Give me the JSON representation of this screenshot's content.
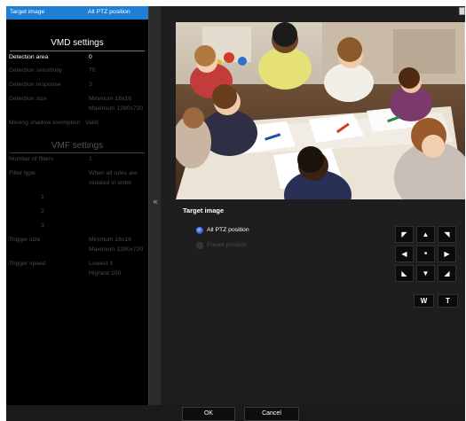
{
  "settings_panel": {
    "target_row": {
      "label": "Target image",
      "value": "All PTZ position"
    },
    "vmd_title": "VMD settings",
    "vmd_rows": [
      {
        "label": "Detection area",
        "value": "0",
        "enabled": true
      },
      {
        "label": "Detection sensitivity",
        "value": "70",
        "enabled": false
      },
      {
        "label": "Detection response",
        "value": "3",
        "enabled": false
      },
      {
        "label": "Detection size",
        "value": "Minimum 16x16",
        "value2": "Maximum 1280x720",
        "enabled": false
      },
      {
        "label": "Moving shadow exemption",
        "value": "Valid",
        "enabled": false
      }
    ],
    "vmf_title": "VMF settings",
    "vmf_rows": [
      {
        "label": "Number of filters",
        "value": "1"
      },
      {
        "label": "Filter type",
        "value": "When all rules are",
        "value2": "violated in order"
      },
      {
        "label": "1",
        "value": ""
      },
      {
        "label": "2",
        "value": ""
      },
      {
        "label": "3",
        "value": ""
      },
      {
        "label": "Trigger size",
        "value": "Minimum 16x16",
        "value2": "Maximum 1280x720"
      },
      {
        "label": "Trigger speed",
        "value": "Lowest 1",
        "value2": "Highest 100"
      }
    ]
  },
  "divider": {
    "collapse_glyph": "«"
  },
  "main": {
    "target_image_title": "Target image",
    "radio_all_label": "All PTZ position",
    "radio_preset_label": "Preset position",
    "selected_option": "All PTZ position"
  },
  "ptz": {
    "buttons": [
      {
        "name": "ptz-up-left-button",
        "glyph": "◤"
      },
      {
        "name": "ptz-up-button",
        "glyph": "▲"
      },
      {
        "name": "ptz-up-right-button",
        "glyph": "◥"
      },
      {
        "name": "ptz-left-button",
        "glyph": "◀"
      },
      {
        "name": "ptz-home-button",
        "glyph": "■"
      },
      {
        "name": "ptz-right-button",
        "glyph": "▶"
      },
      {
        "name": "ptz-down-left-button",
        "glyph": "◣"
      },
      {
        "name": "ptz-down-button",
        "glyph": "▼"
      },
      {
        "name": "ptz-down-right-button",
        "glyph": "◢"
      }
    ],
    "zoom_wide_label": "W",
    "zoom_tele_label": "T"
  },
  "footer": {
    "ok_label": "OK",
    "cancel_label": "Cancel"
  },
  "colors": {
    "highlight": "#1f7fd4",
    "panel_bg": "#000000",
    "main_bg": "#1e1e1e",
    "disabled_text": "#4a4a4a"
  }
}
